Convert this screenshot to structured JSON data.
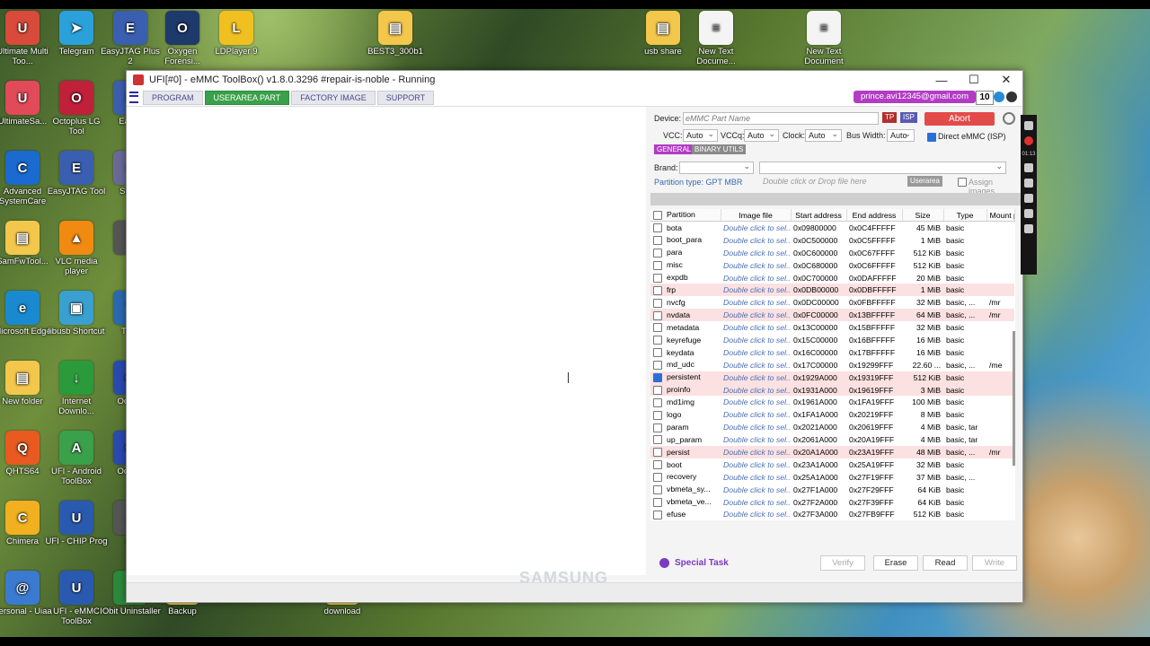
{
  "desktop": {
    "icons": [
      {
        "label": "Ultimate Multi Too...",
        "color": "#d84a3a",
        "glyph": "U"
      },
      {
        "label": "Telegram",
        "color": "#2aa1db",
        "glyph": "➤"
      },
      {
        "label": "EasyJTAG Plus 2",
        "color": "#3a5fb0",
        "glyph": "E"
      },
      {
        "label": "Oxygen Forensi...",
        "color": "#1e3a6a",
        "glyph": "O"
      },
      {
        "label": "LDPlayer 9",
        "color": "#f0c020",
        "glyph": "L"
      },
      {
        "label": "BEST3_300b1",
        "color": "#f3c74b",
        "glyph": "▤"
      },
      {
        "label": "usb share",
        "color": "#f3c74b",
        "glyph": "▤"
      },
      {
        "label": "New Text Docume...",
        "color": "#f4f4f4",
        "glyph": "≡"
      },
      {
        "label": "New Text Document",
        "color": "#f4f4f4",
        "glyph": "≡"
      },
      {
        "label": "UltimateSa...",
        "color": "#e24a5a",
        "glyph": "U"
      },
      {
        "label": "Octoplus LG Tool",
        "color": "#c0203a",
        "glyph": "O"
      },
      {
        "label": "Eas P",
        "color": "#3a5fb0",
        "glyph": "E"
      },
      {
        "label": "Advanced SystemCare",
        "color": "#1a6ad0",
        "glyph": "C"
      },
      {
        "label": "EasyJTAG Tool",
        "color": "#3a5fb0",
        "glyph": "E"
      },
      {
        "label": "Softw",
        "color": "#6a6a9a",
        "glyph": "S"
      },
      {
        "label": "SamFwTool...",
        "color": "#f3c74b",
        "glyph": "▤"
      },
      {
        "label": "VLC media player",
        "color": "#f08a10",
        "glyph": "▲"
      },
      {
        "label": "fr",
        "color": "#555",
        "glyph": "f"
      },
      {
        "label": "Microsoft Edge",
        "color": "#1a8ad0",
        "glyph": "e"
      },
      {
        "label": "libusb Shortcut",
        "color": "#3aa0d0",
        "glyph": "▣"
      },
      {
        "label": "TSM",
        "color": "#2a6ab0",
        "glyph": "T"
      },
      {
        "label": "New folder",
        "color": "#f3c74b",
        "glyph": "▤"
      },
      {
        "label": "Internet Downlo...",
        "color": "#2a9a3a",
        "glyph": "↓"
      },
      {
        "label": "Oct Sa",
        "color": "#2a4ab0",
        "glyph": "O"
      },
      {
        "label": "QHTS64",
        "color": "#e85a20",
        "glyph": "Q"
      },
      {
        "label": "UFI - Android ToolBox",
        "color": "#3aa04a",
        "glyph": "A"
      },
      {
        "label": "Oct Sa",
        "color": "#2a4ab0",
        "glyph": "O"
      },
      {
        "label": "Chimera",
        "color": "#f0b020",
        "glyph": "C"
      },
      {
        "label": "UFI - CHIP Prog",
        "color": "#2a5ab0",
        "glyph": "U"
      },
      {
        "label": "se",
        "color": "#555",
        "glyph": "s"
      },
      {
        "label": "Personal - Uiaa",
        "color": "#3a7ad0",
        "glyph": "@"
      },
      {
        "label": "UFI - eMMC ToolBox",
        "color": "#2a5ab0",
        "glyph": "U"
      },
      {
        "label": "IObit Uninstaller",
        "color": "#2a8a3a",
        "glyph": "I"
      },
      {
        "label": "Backup",
        "color": "#f3c74b",
        "glyph": "▤"
      },
      {
        "label": "download",
        "color": "#f3c74b",
        "glyph": "▤"
      }
    ]
  },
  "window": {
    "title": "UFI[#0] - eMMC ToolBox() v1.8.0.3296 #repair-is-noble - Running",
    "min": "—",
    "max": "☐",
    "close": "✕"
  },
  "menu": {
    "tabs": [
      {
        "label": "PROGRAM",
        "active": false
      },
      {
        "label": "USERAREA PART",
        "active": true
      },
      {
        "label": "FACTORY IMAGE",
        "active": false
      },
      {
        "label": "SUPPORT",
        "active": false
      }
    ],
    "user": "prince.avi12345@gmail.com",
    "credits": "10"
  },
  "left": {
    "watermark": "SAMSUNG"
  },
  "device": {
    "device_label": "Device:",
    "device_placeholder": "eMMC Part Name",
    "tp": "TP",
    "isp": "ISP",
    "abort": "Abort",
    "vcc_label": "VCC:",
    "vcc": "Auto",
    "vccq_label": "VCCq:",
    "vccq": "Auto",
    "clock_label": "Clock:",
    "clock": "Auto",
    "bus_label": "Bus Width:",
    "bus": "Auto",
    "direct_label": "Direct eMMC (ISP)",
    "general": "GENERAL",
    "binary": "BINARY UTILS",
    "brand_label": "Brand:",
    "partition_type": "Partition type: GPT MBR",
    "drop_placeholder": "Double click or Drop file here",
    "userarea": "Userarea",
    "assign": "Assign images"
  },
  "table": {
    "headers": [
      "Partition",
      "Image file",
      "Start address",
      "End address",
      "Size",
      "Type",
      "Mount p"
    ],
    "rows": [
      {
        "name": "bota",
        "image": "Double click to sel...",
        "start": "0x09800000",
        "end": "0x0C4FFFFF",
        "size": "45 MiB",
        "type": "basic",
        "mount": "",
        "hl": false,
        "checked": false
      },
      {
        "name": "boot_para",
        "image": "Double click to sel...",
        "start": "0x0C500000",
        "end": "0x0C5FFFFF",
        "size": "1 MiB",
        "type": "basic",
        "mount": "",
        "hl": false,
        "checked": false
      },
      {
        "name": "para",
        "image": "Double click to sel...",
        "start": "0x0C600000",
        "end": "0x0C67FFFF",
        "size": "512 KiB",
        "type": "basic",
        "mount": "",
        "hl": false,
        "checked": false
      },
      {
        "name": "misc",
        "image": "Double click to sel...",
        "start": "0x0C680000",
        "end": "0x0C6FFFFF",
        "size": "512 KiB",
        "type": "basic",
        "mount": "",
        "hl": false,
        "checked": false
      },
      {
        "name": "expdb",
        "image": "Double click to sel...",
        "start": "0x0C700000",
        "end": "0x0DAFFFFF",
        "size": "20 MiB",
        "type": "basic",
        "mount": "",
        "hl": false,
        "checked": false
      },
      {
        "name": "frp",
        "image": "Double click to sel...",
        "start": "0x0DB00000",
        "end": "0x0DBFFFFF",
        "size": "1 MiB",
        "type": "basic",
        "mount": "",
        "hl": true,
        "checked": false
      },
      {
        "name": "nvcfg",
        "image": "Double click to sel...",
        "start": "0x0DC00000",
        "end": "0x0FBFFFFF",
        "size": "32 MiB",
        "type": "basic, ...",
        "mount": "/mr",
        "hl": false,
        "checked": false
      },
      {
        "name": "nvdata",
        "image": "Double click to sel...",
        "start": "0x0FC00000",
        "end": "0x13BFFFFF",
        "size": "64 MiB",
        "type": "basic, ...",
        "mount": "/mr",
        "hl": true,
        "checked": false
      },
      {
        "name": "metadata",
        "image": "Double click to sel...",
        "start": "0x13C00000",
        "end": "0x15BFFFFF",
        "size": "32 MiB",
        "type": "basic",
        "mount": "",
        "hl": false,
        "checked": false
      },
      {
        "name": "keyrefuge",
        "image": "Double click to sel...",
        "start": "0x15C00000",
        "end": "0x16BFFFFF",
        "size": "16 MiB",
        "type": "basic",
        "mount": "",
        "hl": false,
        "checked": false
      },
      {
        "name": "keydata",
        "image": "Double click to sel...",
        "start": "0x16C00000",
        "end": "0x17BFFFFF",
        "size": "16 MiB",
        "type": "basic",
        "mount": "",
        "hl": false,
        "checked": false
      },
      {
        "name": "md_udc",
        "image": "Double click to sel...",
        "start": "0x17C00000",
        "end": "0x19299FFF",
        "size": "22.60 ...",
        "type": "basic, ...",
        "mount": "/me",
        "hl": false,
        "checked": false
      },
      {
        "name": "persistent",
        "image": "Double click to sel...",
        "start": "0x1929A000",
        "end": "0x19319FFF",
        "size": "512 KiB",
        "type": "basic",
        "mount": "",
        "hl": true,
        "checked": true
      },
      {
        "name": "proinfo",
        "image": "Double click to sel...",
        "start": "0x1931A000",
        "end": "0x19619FFF",
        "size": "3 MiB",
        "type": "basic",
        "mount": "",
        "hl": true,
        "checked": false
      },
      {
        "name": "md1img",
        "image": "Double click to sel...",
        "start": "0x1961A000",
        "end": "0x1FA19FFF",
        "size": "100 MiB",
        "type": "basic",
        "mount": "",
        "hl": false,
        "checked": false
      },
      {
        "name": "logo",
        "image": "Double click to sel...",
        "start": "0x1FA1A000",
        "end": "0x20219FFF",
        "size": "8 MiB",
        "type": "basic",
        "mount": "",
        "hl": false,
        "checked": false
      },
      {
        "name": "param",
        "image": "Double click to sel...",
        "start": "0x2021A000",
        "end": "0x20619FFF",
        "size": "4 MiB",
        "type": "basic, tar",
        "mount": "",
        "hl": false,
        "checked": false
      },
      {
        "name": "up_param",
        "image": "Double click to sel...",
        "start": "0x2061A000",
        "end": "0x20A19FFF",
        "size": "4 MiB",
        "type": "basic, tar",
        "mount": "",
        "hl": false,
        "checked": false
      },
      {
        "name": "persist",
        "image": "Double click to sel...",
        "start": "0x20A1A000",
        "end": "0x23A19FFF",
        "size": "48 MiB",
        "type": "basic, ...",
        "mount": "/mr",
        "hl": true,
        "checked": false
      },
      {
        "name": "boot",
        "image": "Double click to sel...",
        "start": "0x23A1A000",
        "end": "0x25A19FFF",
        "size": "32 MiB",
        "type": "basic",
        "mount": "",
        "hl": false,
        "checked": false
      },
      {
        "name": "recovery",
        "image": "Double click to sel...",
        "start": "0x25A1A000",
        "end": "0x27F19FFF",
        "size": "37 MiB",
        "type": "basic, ...",
        "mount": "",
        "hl": false,
        "checked": false
      },
      {
        "name": "vbmeta_sy...",
        "image": "Double click to sel...",
        "start": "0x27F1A000",
        "end": "0x27F29FFF",
        "size": "64 KiB",
        "type": "basic",
        "mount": "",
        "hl": false,
        "checked": false
      },
      {
        "name": "vbmeta_ve...",
        "image": "Double click to sel...",
        "start": "0x27F2A000",
        "end": "0x27F39FFF",
        "size": "64 KiB",
        "type": "basic",
        "mount": "",
        "hl": false,
        "checked": false
      },
      {
        "name": "efuse",
        "image": "Double click to sel...",
        "start": "0x27F3A000",
        "end": "0x27FB9FFF",
        "size": "512 KiB",
        "type": "basic",
        "mount": "",
        "hl": false,
        "checked": false
      }
    ]
  },
  "actions": {
    "special": "Special Task",
    "verify": "Verify",
    "erase": "Erase",
    "read": "Read",
    "write": "Write"
  },
  "recorder": {
    "time": "01:13"
  },
  "colors": {
    "accent_green": "#3aa04a",
    "user_purple": "#b23cc4",
    "abort_red": "#e34b4b",
    "row_highlight": "#fbe1e1",
    "link_blue": "#4a6fb5"
  }
}
